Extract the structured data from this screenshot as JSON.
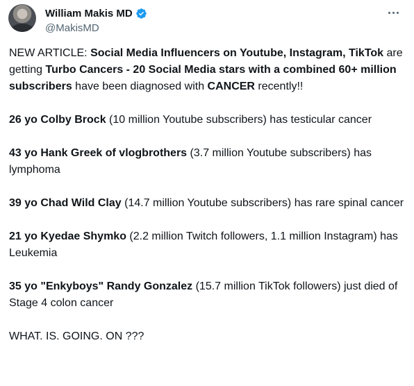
{
  "author": {
    "display_name": "William Makis MD",
    "handle": "@MakisMD",
    "verified_icon": "verified-badge-icon",
    "verified_color": "#1d9bf0"
  },
  "menu": {
    "icon": "more-horizontal-icon"
  },
  "tweet": {
    "intro": {
      "t1": "NEW ARTICLE: ",
      "t2": "Social Media Influencers on Youtube, Instagram, TikTok",
      "t3": " are getting ",
      "t4": "Turbo Cancers - 20 Social Media stars with a combined 60+ million subscribers",
      "t5": " have been diagnosed with ",
      "t6": "CANCER",
      "t7": " recently!!"
    },
    "cases": [
      {
        "name": "26 yo Colby Brock",
        "detail": " (10 million Youtube subscribers) has testicular cancer"
      },
      {
        "name": "43 yo Hank Greek of vlogbrothers",
        "detail": " (3.7 million Youtube subscribers) has lymphoma"
      },
      {
        "name": "39 yo Chad Wild Clay",
        "detail": " (14.7 million Youtube subscribers) has rare spinal cancer"
      },
      {
        "name": "21 yo Kyedae Shymko",
        "detail": " (2.2 million Twitch followers, 1.1 million Instagram) has Leukemia"
      },
      {
        "name": "35 yo \"Enkyboys\" Randy Gonzalez",
        "detail": " (15.7 million TikTok followers) just died of Stage 4 colon cancer"
      }
    ],
    "closing": "WHAT. IS. GOING. ON ???"
  }
}
